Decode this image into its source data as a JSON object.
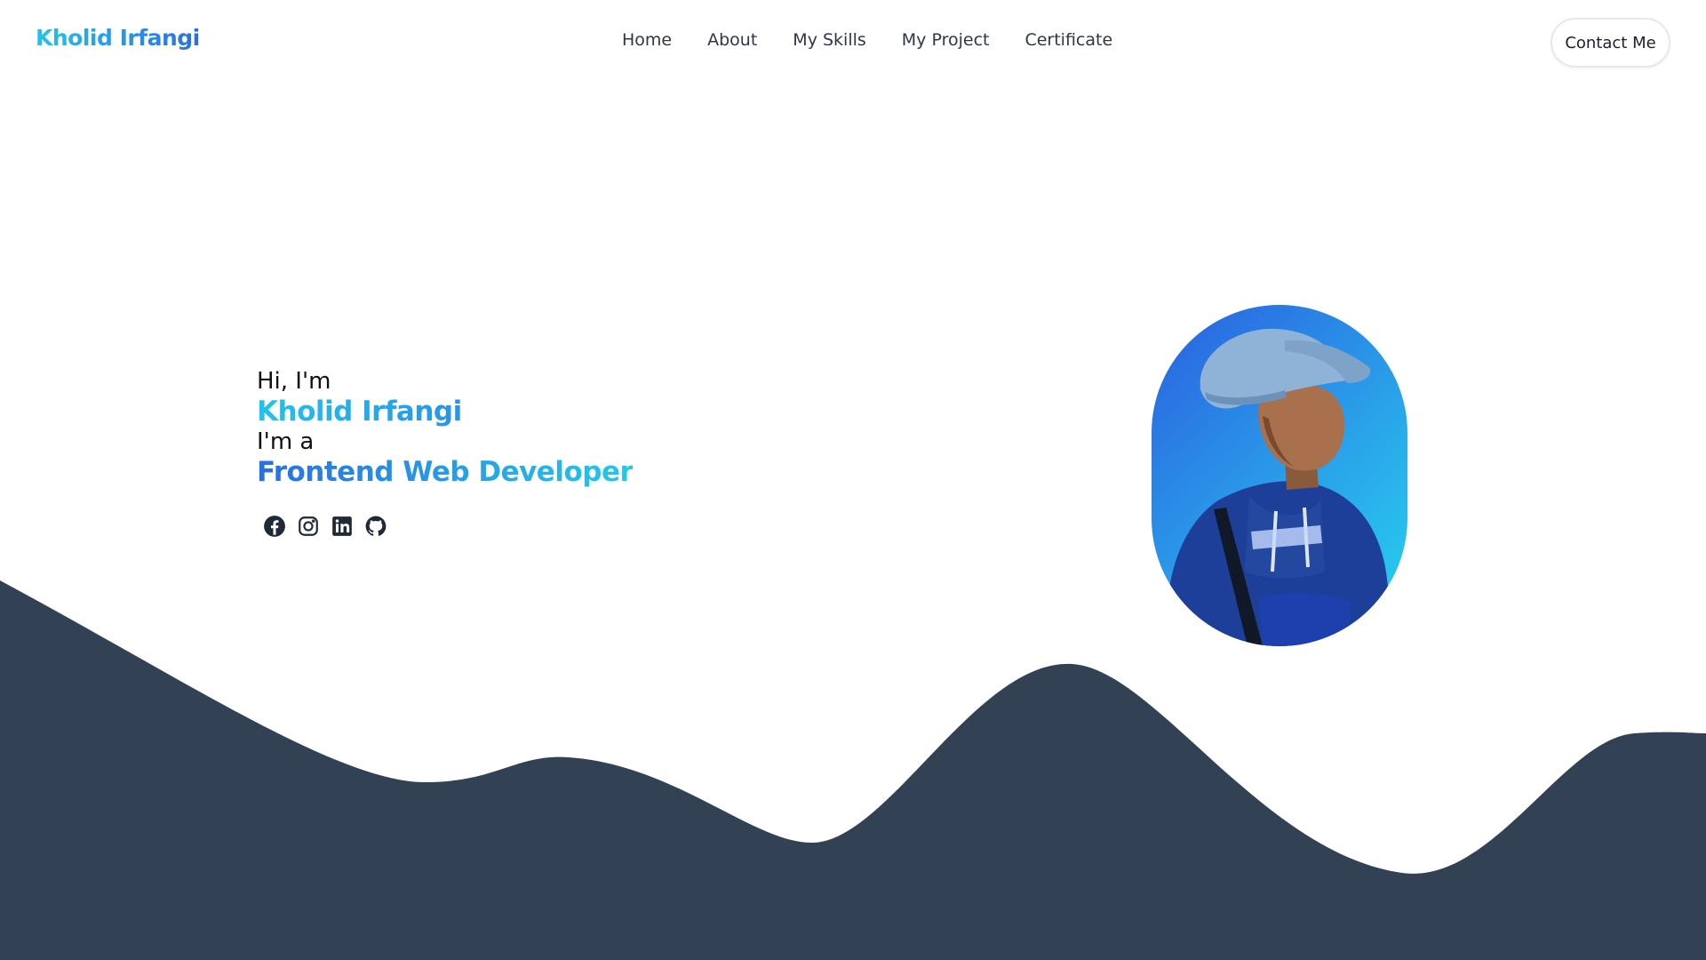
{
  "header": {
    "brand": "Kholid Irfangi",
    "nav": [
      "Home",
      "About",
      "My Skills",
      "My Project",
      "Certificate"
    ],
    "contact_label": "Contact Me"
  },
  "hero": {
    "greeting": "Hi, I'm",
    "name": "Kholid Irfangi",
    "role_intro": "I'm a",
    "role": "Frontend Web Developer",
    "socials": [
      "facebook-icon",
      "instagram-icon",
      "linkedin-icon",
      "github-icon"
    ]
  },
  "colors": {
    "gradient_start": "#22c3ee",
    "gradient_end": "#2a6fe0",
    "wave": "#334155",
    "nav_text": "#2d3748"
  }
}
